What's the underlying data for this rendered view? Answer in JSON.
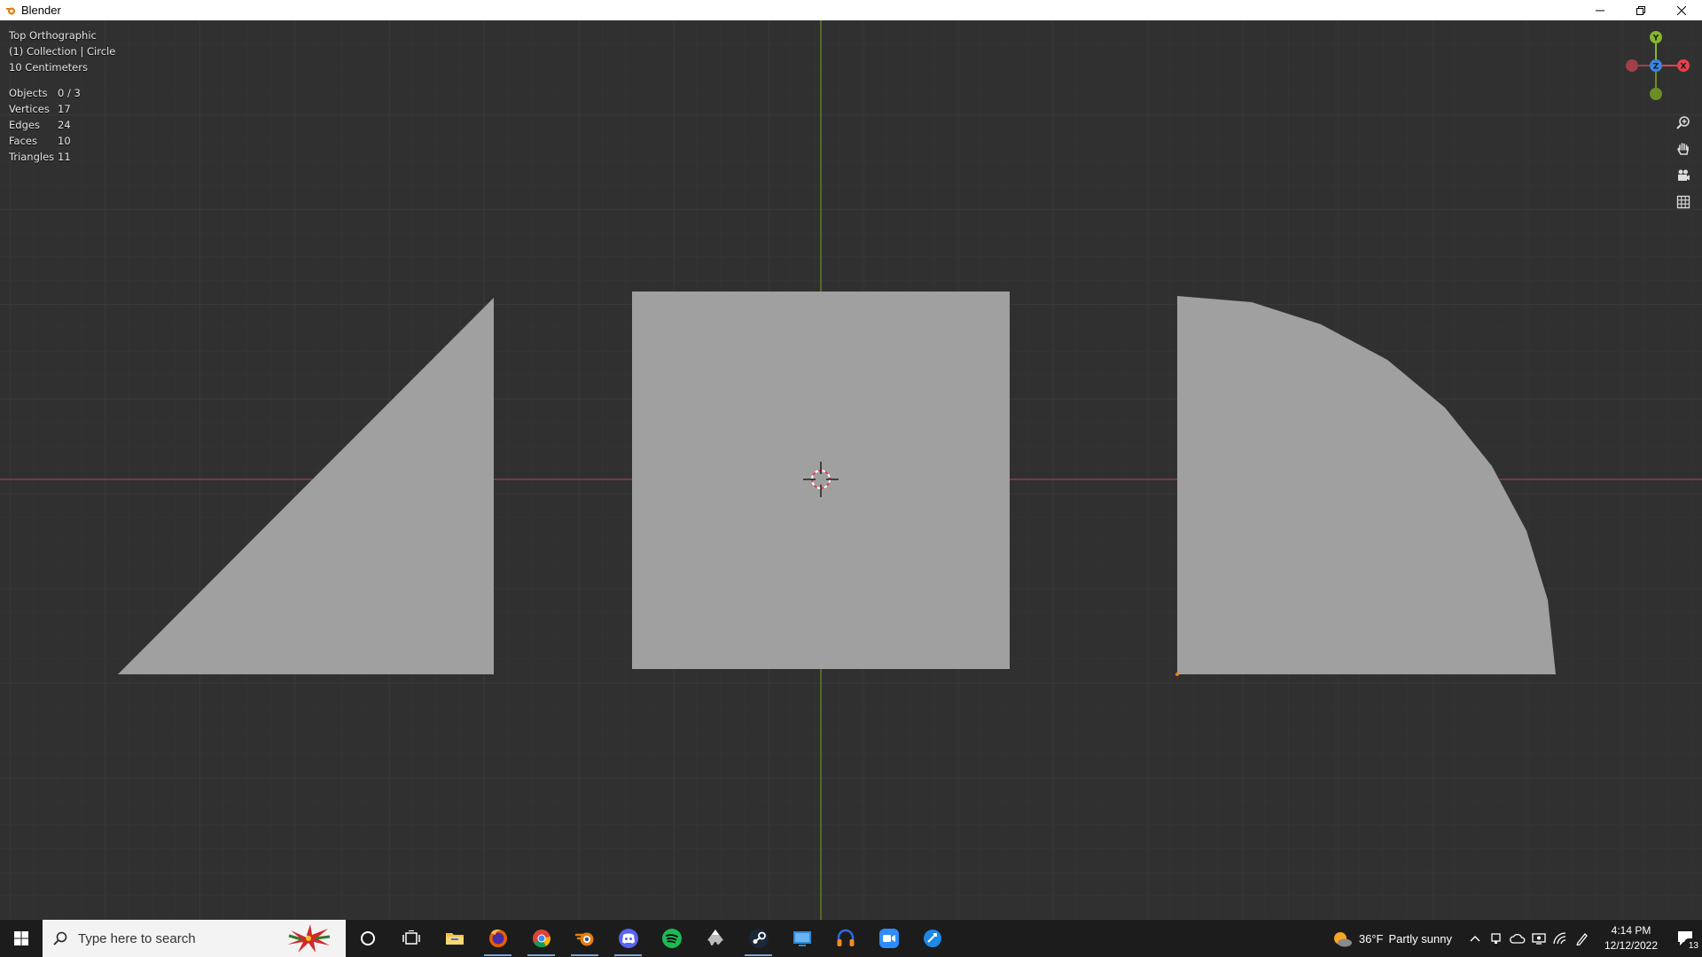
{
  "window": {
    "title": "Blender"
  },
  "viewport": {
    "view_name": "Top Orthographic",
    "collection": "(1) Collection | Circle",
    "scale": "10 Centimeters",
    "stats": [
      {
        "label": "Objects",
        "value": "0 / 3"
      },
      {
        "label": "Vertices",
        "value": "17"
      },
      {
        "label": "Edges",
        "value": "24"
      },
      {
        "label": "Faces",
        "value": "10"
      },
      {
        "label": "Triangles",
        "value": "11"
      }
    ],
    "gizmo": {
      "y": "Y",
      "z": "Z",
      "x": "X"
    },
    "colors": {
      "background": "#303030",
      "mesh": "#a0a0a0",
      "x_axis": "#9c3f48",
      "y_axis": "#6a8e23",
      "gizmo_x": "#e5404f",
      "gizmo_y": "#84b82a",
      "gizmo_z": "#3a87e0"
    },
    "nav_icons": [
      "zoom-icon",
      "hand-pan-icon",
      "camera-icon",
      "grid-icon"
    ]
  },
  "taskbar": {
    "search_placeholder": "Type here to search",
    "apps": [
      "cortana-icon",
      "task-view-icon",
      "file-explorer-icon",
      "firefox-icon",
      "chrome-icon",
      "blender-icon",
      "discord-icon",
      "spotify-icon",
      "inkscape-icon",
      "steam-icon",
      "remote-desktop-icon",
      "headset-icon",
      "zoom-icon",
      "app-icon"
    ],
    "weather": {
      "temp": "36°F",
      "condition": "Partly sunny"
    },
    "time": "4:14 PM",
    "date": "12/12/2022",
    "notifications": "13"
  }
}
